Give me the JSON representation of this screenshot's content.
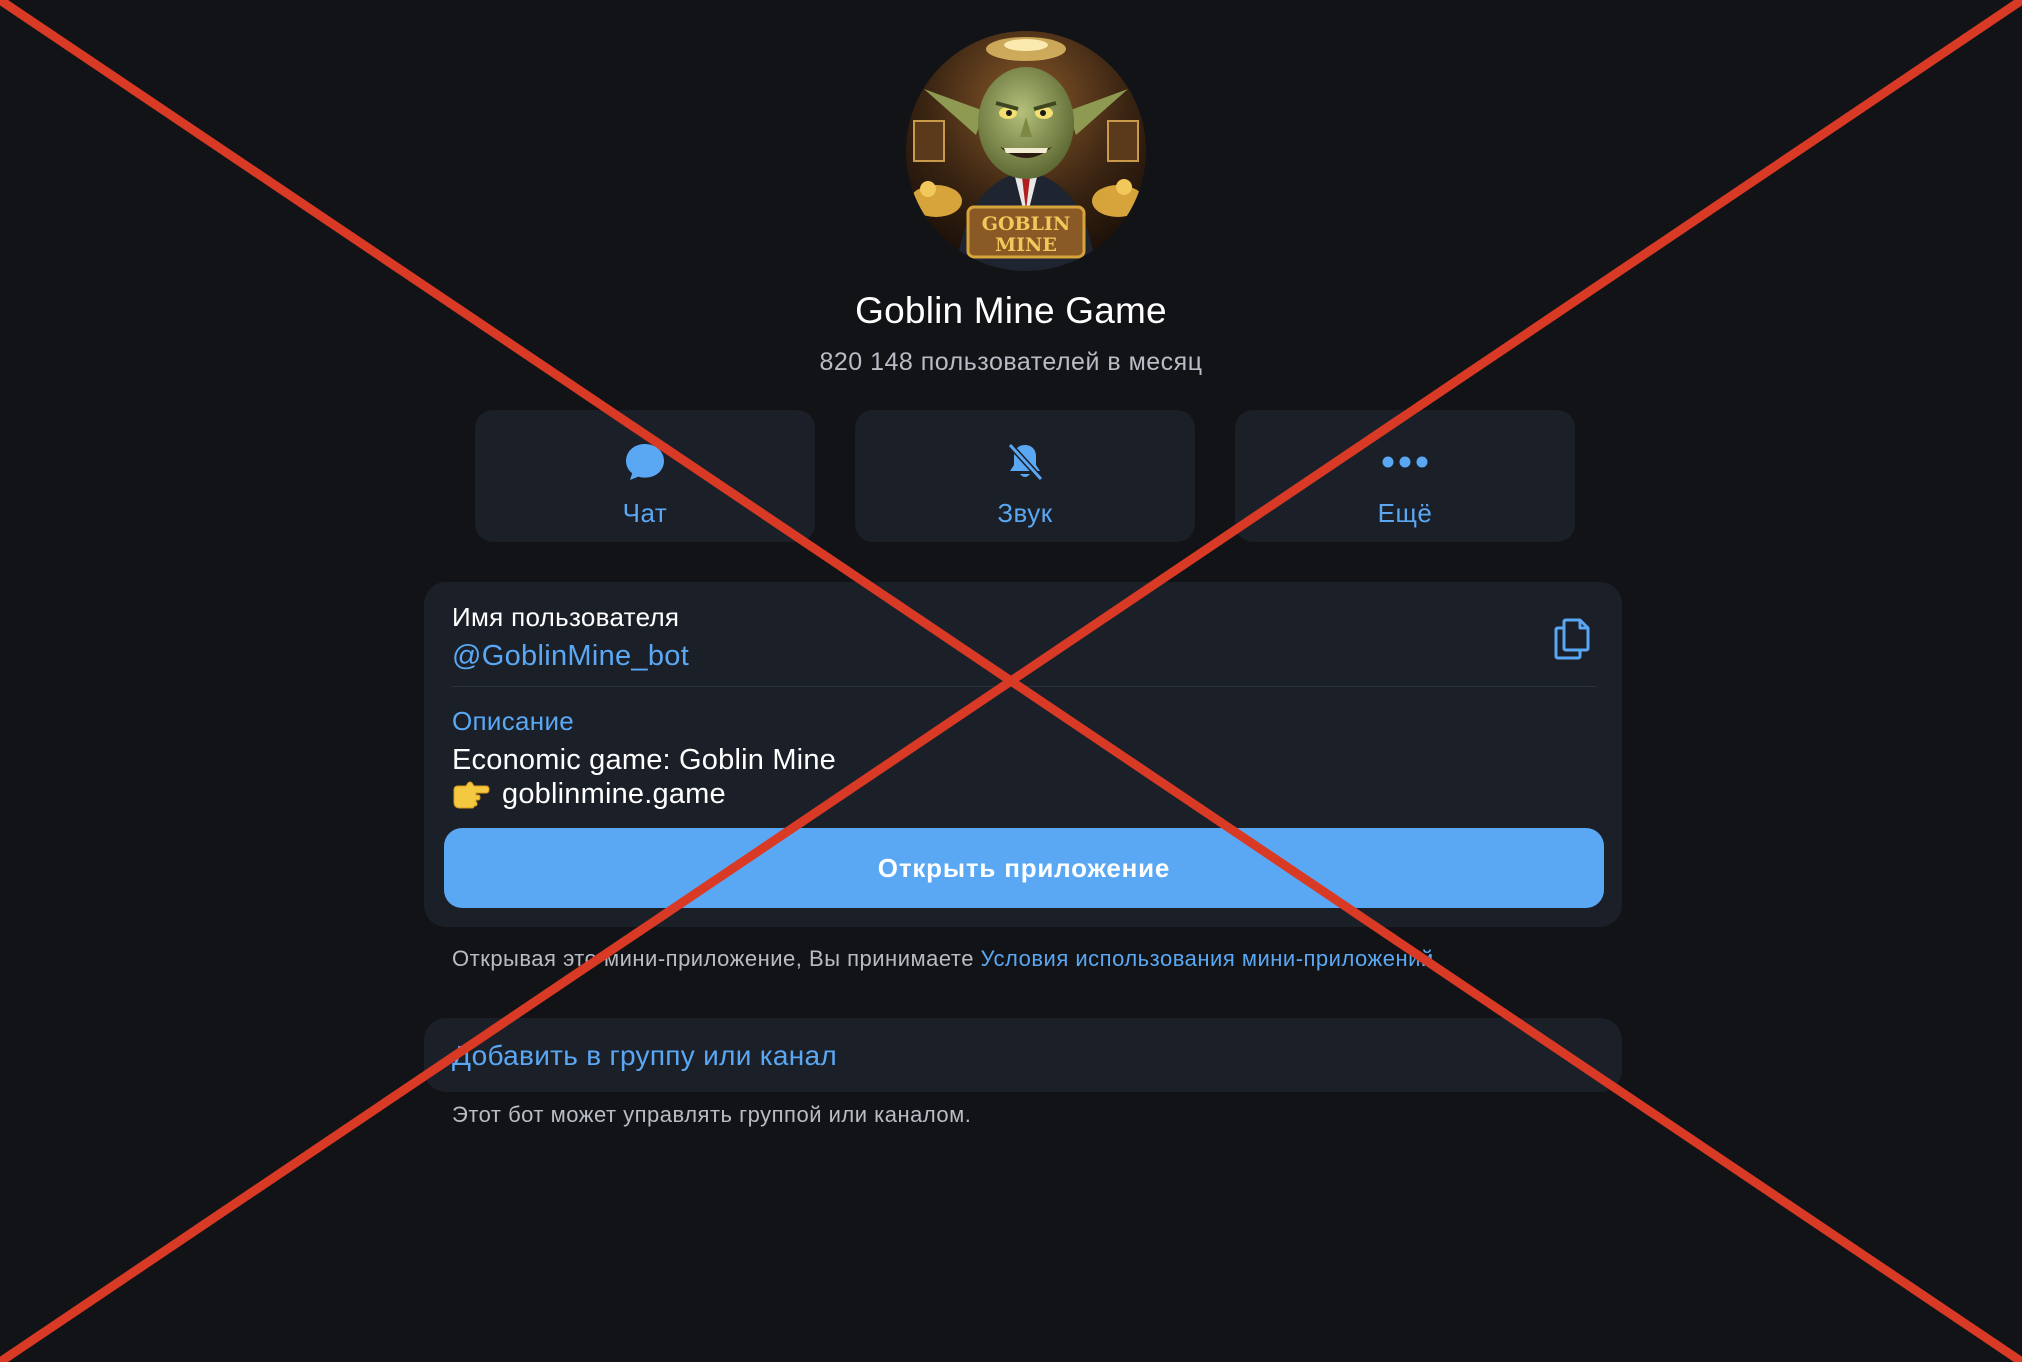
{
  "profile": {
    "avatar_icon": "goblin-mine-avatar",
    "avatar_text_line1": "GOBLIN",
    "avatar_text_line2": "MINE",
    "name": "Goblin Mine Game",
    "subtitle": "820 148 пользователей в месяц"
  },
  "actions": [
    {
      "icon": "chat-bubble-icon",
      "label": "Чат"
    },
    {
      "icon": "bell-muted-icon",
      "label": "Звук"
    },
    {
      "icon": "more-dots-icon",
      "label": "Ещё"
    }
  ],
  "info": {
    "username_label": "Имя пользователя",
    "username_value": "@GoblinMine_bot",
    "copy_icon": "copy-icon",
    "description_label": "Описание",
    "description_line1": "Economic game: Goblin Mine",
    "description_line2_emoji": "👉",
    "description_line2_text": "goblinmine.game",
    "open_button": "Открыть приложение"
  },
  "terms": {
    "prefix": "Открывая это мини-приложение, Вы принимаете ",
    "link": "Условия использования мини-приложений",
    "suffix": "."
  },
  "add": {
    "label": "Добавить в группу или канал",
    "hint": "Этот бот может управлять группой или каналом."
  },
  "overlay": {
    "icon": "red-cross-out",
    "color": "#d93a26"
  },
  "colors": {
    "background": "#121316",
    "card": "#1b1f28",
    "accent": "#5aa8f4",
    "text_primary": "#ffffff",
    "text_secondary": "#b8bcc4"
  }
}
